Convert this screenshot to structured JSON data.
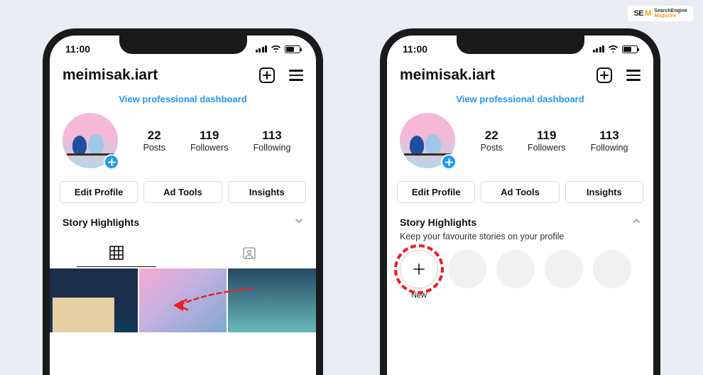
{
  "watermark": {
    "se": "SE",
    "m": "M",
    "line1": "SearchEngine",
    "line2": "Magazine"
  },
  "status": {
    "time": "11:00"
  },
  "profile": {
    "username": "meimisak.iart",
    "dashboard_link": "View professional dashboard",
    "stats": {
      "posts": {
        "count": "22",
        "label": "Posts"
      },
      "followers": {
        "count": "119",
        "label": "Followers"
      },
      "following": {
        "count": "113",
        "label": "Following"
      }
    }
  },
  "buttons": {
    "edit_profile": "Edit Profile",
    "ad_tools": "Ad Tools",
    "insights": "Insights"
  },
  "highlights": {
    "title": "Story Highlights",
    "subtitle": "Keep your favourite stories on your profile",
    "new_label": "New"
  },
  "colors": {
    "accent_blue": "#2196f3",
    "annotation_red": "#ef1c22"
  }
}
